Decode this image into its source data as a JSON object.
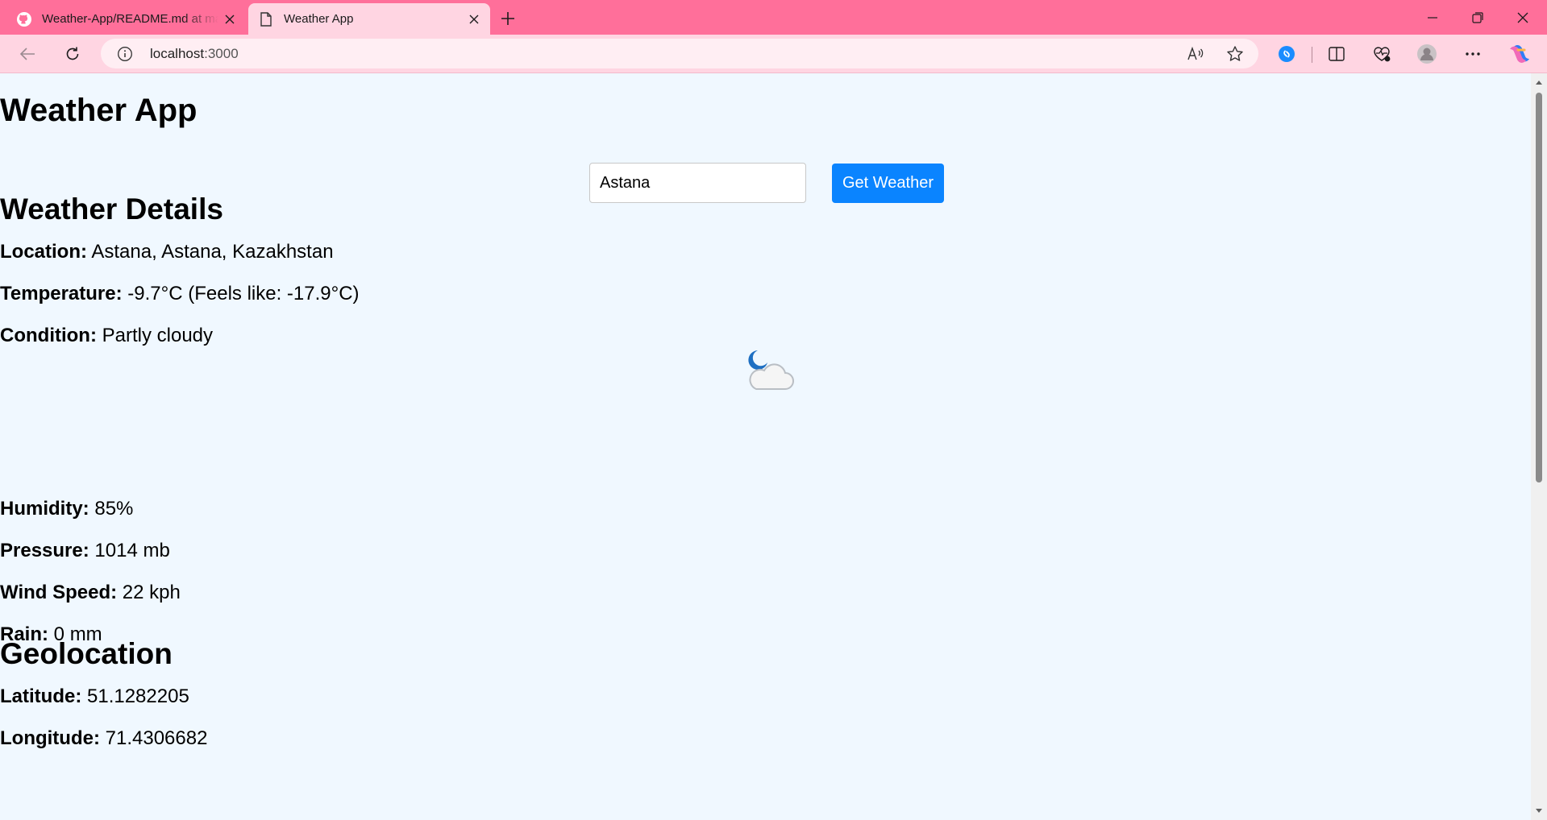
{
  "browser": {
    "tabs": [
      {
        "title": "Weather-App/README.md at main",
        "icon": "github-icon",
        "active": false
      },
      {
        "title": "Weather App",
        "icon": "page-icon",
        "active": true
      }
    ],
    "address": {
      "host": "localhost",
      "port": ":3000"
    }
  },
  "app": {
    "title": "Weather App",
    "search": {
      "value": "Astana",
      "button_label": "Get Weather"
    }
  },
  "details": {
    "heading": "Weather Details",
    "location": {
      "label": "Location:",
      "value": "Astana, Astana, Kazakhstan"
    },
    "temperature": {
      "label": "Temperature:",
      "value": "-9.7°C (Feels like: -17.9°C)"
    },
    "condition": {
      "label": "Condition:",
      "value": "Partly cloudy",
      "icon": "partly-cloudy-night-icon"
    },
    "humidity": {
      "label": "Humidity:",
      "value": "85%"
    },
    "pressure": {
      "label": "Pressure:",
      "value": "1014 mb"
    },
    "wind": {
      "label": "Wind Speed:",
      "value": "22 kph"
    },
    "rain": {
      "label": "Rain:",
      "value": "0 mm"
    }
  },
  "geo": {
    "heading": "Geolocation",
    "latitude": {
      "label": "Latitude:",
      "value": "51.1282205"
    },
    "longitude": {
      "label": "Longitude:",
      "value": "71.4306682"
    }
  },
  "colors": {
    "tabbar": "#ff6f9a",
    "toolbar": "#ffd5e2",
    "page_bg": "#f0f8ff",
    "button": "#0a84ff"
  }
}
